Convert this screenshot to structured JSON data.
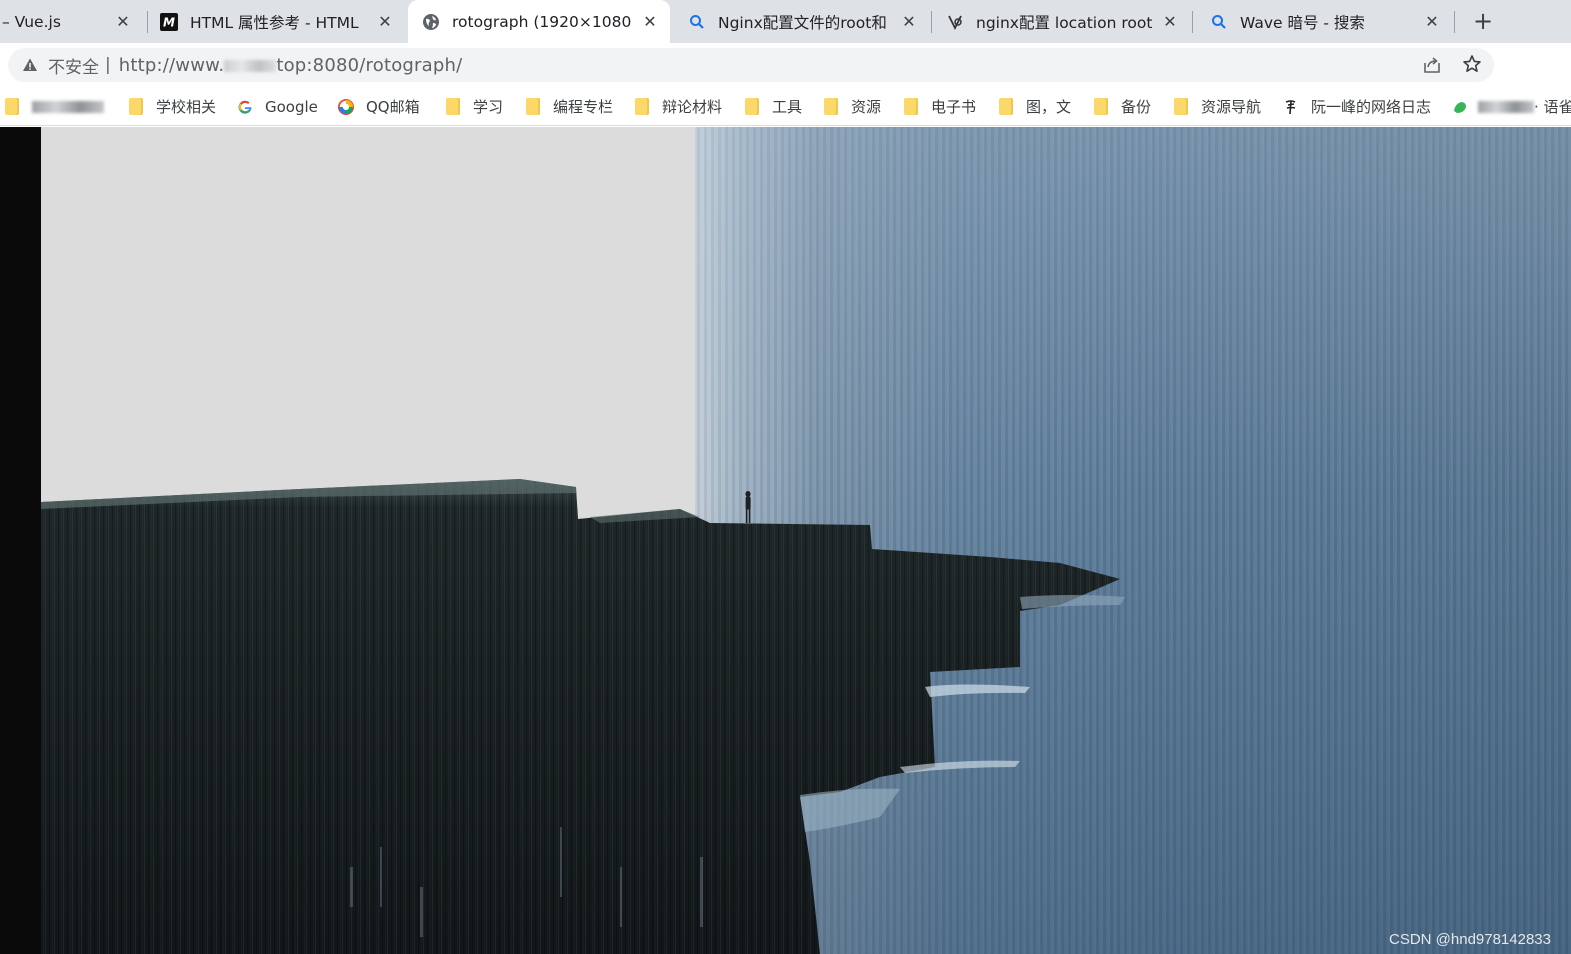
{
  "tabs": [
    {
      "title": "– Vue.js",
      "icon": "vue-icon",
      "active": false
    },
    {
      "title": "HTML 属性参考 - HTML（",
      "icon": "mdn-icon",
      "active": false
    },
    {
      "title": "rotograph (1920×1080)",
      "icon": "globe-icon",
      "active": true
    },
    {
      "title": "Nginx配置文件的root和 - ",
      "icon": "search-icon",
      "active": false
    },
    {
      "title": "nginx配置 location root -",
      "icon": "site-icon",
      "active": false
    },
    {
      "title": "Wave 暗号 - 搜索",
      "icon": "search-icon",
      "active": false
    }
  ],
  "new_tab_label": "+",
  "address": {
    "security_label": "不安全",
    "url_prefix": "http://www.",
    "url_suffix": "top:8080/rotograph/"
  },
  "bookmarks": [
    {
      "label": "",
      "icon": "folder-icon",
      "blurred": true
    },
    {
      "label": "学校相关",
      "icon": "folder-icon"
    },
    {
      "label": "Google",
      "icon": "google-icon"
    },
    {
      "label": "QQ邮箱",
      "icon": "qqmail-icon"
    },
    {
      "label": "学习",
      "icon": "folder-icon"
    },
    {
      "label": "编程专栏",
      "icon": "folder-icon"
    },
    {
      "label": "辩论材料",
      "icon": "folder-icon"
    },
    {
      "label": "工具",
      "icon": "folder-icon"
    },
    {
      "label": "资源",
      "icon": "folder-icon"
    },
    {
      "label": "电子书",
      "icon": "folder-icon"
    },
    {
      "label": "图，文",
      "icon": "folder-icon"
    },
    {
      "label": "备份",
      "icon": "folder-icon"
    },
    {
      "label": "资源导航",
      "icon": "folder-icon"
    },
    {
      "label": "阮一峰的网络日志",
      "icon": "ruanyf-icon"
    },
    {
      "label": "· 语雀",
      "icon": "yuque-icon",
      "blurred": true
    }
  ],
  "watermark": "CSDN @hnd978142833",
  "colors": {
    "tabstrip": "#dee1e6",
    "omnibox": "#f1f3f4",
    "folder": "#fcd86a",
    "sky": "#dcdcdc",
    "water": "#5b7b98"
  }
}
